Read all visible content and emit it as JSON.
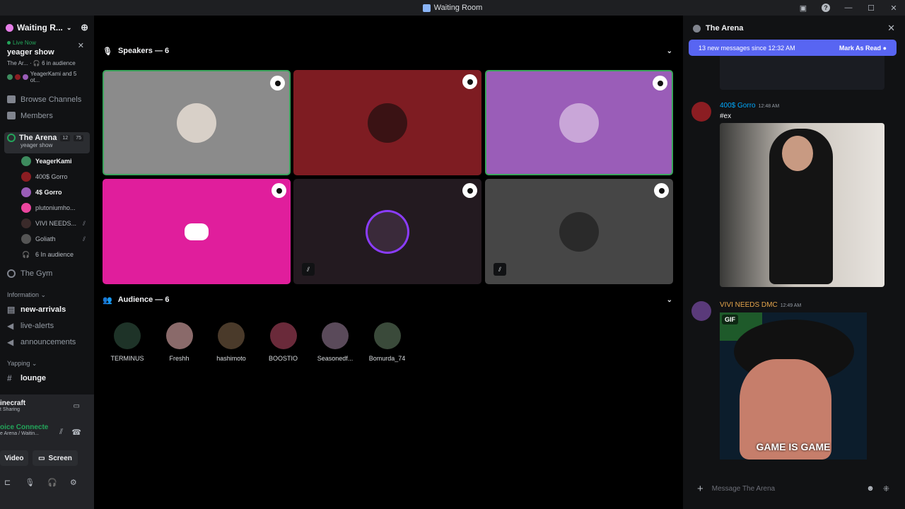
{
  "window": {
    "title": "Waiting Room"
  },
  "sidebar": {
    "server_name": "Waiting R...",
    "live": {
      "badge": "Live Now",
      "title": "yeager show",
      "channel": "The Ar...",
      "audience": "6 in audience",
      "users": "YeagerKami and 5 ot..."
    },
    "nav": [
      {
        "label": "Browse Channels",
        "icon": "browse-icon"
      },
      {
        "label": "Members",
        "icon": "members-icon"
      }
    ],
    "arena": {
      "name": "The Arena",
      "count_a": "12",
      "count_b": "75",
      "sub": "yeager show"
    },
    "voice_members": [
      {
        "name": "YeagerKami",
        "bold": true,
        "color": "#3d8b5e"
      },
      {
        "name": "400$ Gorro",
        "bold": false,
        "color": "#8b1d22"
      },
      {
        "name": "4$ Gorro",
        "bold": true,
        "color": "#9a5db8"
      },
      {
        "name": "plutoniumho...",
        "bold": false,
        "color": "#eb459e"
      },
      {
        "name": "VIVI NEEDS...",
        "bold": false,
        "color": "#3a2a2a"
      },
      {
        "name": "Goliath",
        "bold": false,
        "color": "#555"
      }
    ],
    "audience_label": "6 In audience",
    "gym": "The Gym",
    "category_info": "Information",
    "channels_info": [
      {
        "name": "new-arrivals",
        "bright": true
      },
      {
        "name": "live-alerts",
        "bright": false
      },
      {
        "name": "announcements",
        "bright": false
      }
    ],
    "category_yapping": "Yapping",
    "channel_lounge": "lounge",
    "stream": {
      "title": "inecraft",
      "sub": "t Sharing"
    },
    "voice": {
      "status": "oice Connecte",
      "sub": "e Arena / Waitin..."
    },
    "buttons": {
      "video": "Video",
      "screen": "Screen"
    }
  },
  "main": {
    "speakers_label": "Speakers — 6",
    "audience_label": "Audience — 6",
    "tiles": [
      {
        "bg": "#8b8b8b",
        "border": "#3ba55c",
        "avatar": "#d8d0c8"
      },
      {
        "bg": "#7e1c22",
        "border": "none",
        "avatar": "#3a1214"
      },
      {
        "bg": "#9a5db8",
        "border": "#3ba55c",
        "avatar": "#c9a6d8"
      },
      {
        "bg": "#e01e9c",
        "border": "none",
        "avatar": ""
      },
      {
        "bg": "#231a20",
        "border": "none",
        "avatar": "#3a2a3a"
      },
      {
        "bg": "#464646",
        "border": "none",
        "avatar": "#2a2a2a"
      }
    ],
    "audience": [
      {
        "name": "TERMINUS",
        "color": "#1e3328"
      },
      {
        "name": "Freshh",
        "color": "#8a6a6a"
      },
      {
        "name": "hashimoto",
        "color": "#4a3a2a"
      },
      {
        "name": "BOOSTIO",
        "color": "#6a2a3a"
      },
      {
        "name": "Seasonedf...",
        "color": "#5a4a5a"
      },
      {
        "name": "Bomurda_74",
        "color": "#3a4a3a"
      }
    ]
  },
  "chat": {
    "title": "The Arena",
    "new_messages": "13 new messages since 12:32 AM",
    "mark_read": "Mark As Read",
    "messages": [
      {
        "author": "400$ Gorro",
        "color": "#00a8fc",
        "time": "12:48 AM",
        "text": "#ex"
      },
      {
        "author": "VIVI NEEDS DMC",
        "color": "#e5a54b",
        "time": "12:49 AM",
        "gif_label": "GIF",
        "gif_caption": "GAME IS GAME"
      }
    ],
    "input_placeholder": "Message The Arena"
  }
}
